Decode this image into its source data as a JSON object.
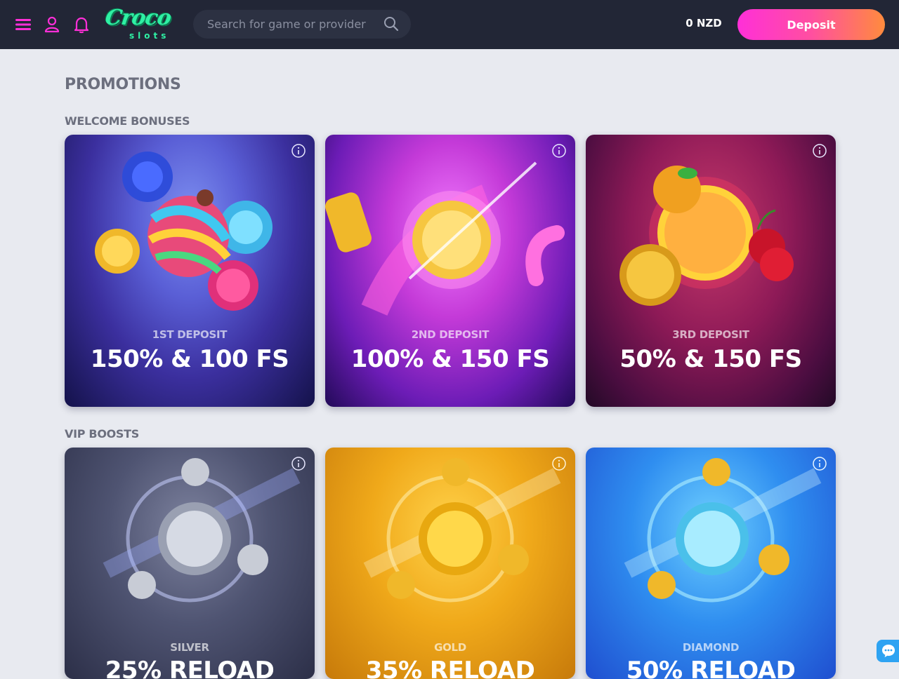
{
  "header": {
    "logo_text": "Croco",
    "logo_sub": "slots",
    "search_placeholder": "Search for game or provider",
    "balance": "0 NZD",
    "deposit_label": "Deposit",
    "icons": [
      "menu-icon",
      "user-icon",
      "bell-icon",
      "search-icon"
    ]
  },
  "colors": {
    "accent_pink": "#ff2fd8",
    "accent_orange": "#ff8b3d",
    "logo_green": "#2ff0a4",
    "header_bg": "#222636"
  },
  "page": {
    "title": "PROMOTIONS"
  },
  "welcome": {
    "title": "WELCOME BONUSES",
    "cards": [
      {
        "label": "1ST DEPOSIT",
        "value": "150% & 100 FS"
      },
      {
        "label": "2ND DEPOSIT",
        "value": "100% & 150 FS"
      },
      {
        "label": "3RD DEPOSIT",
        "value": "50% & 150 FS"
      }
    ]
  },
  "vip": {
    "title": "VIP BOOSTS",
    "cards": [
      {
        "label": "SILVER",
        "value": "25% RELOAD"
      },
      {
        "label": "GOLD",
        "value": "35% RELOAD"
      },
      {
        "label": "DIAMOND",
        "value": "50% RELOAD"
      }
    ]
  }
}
